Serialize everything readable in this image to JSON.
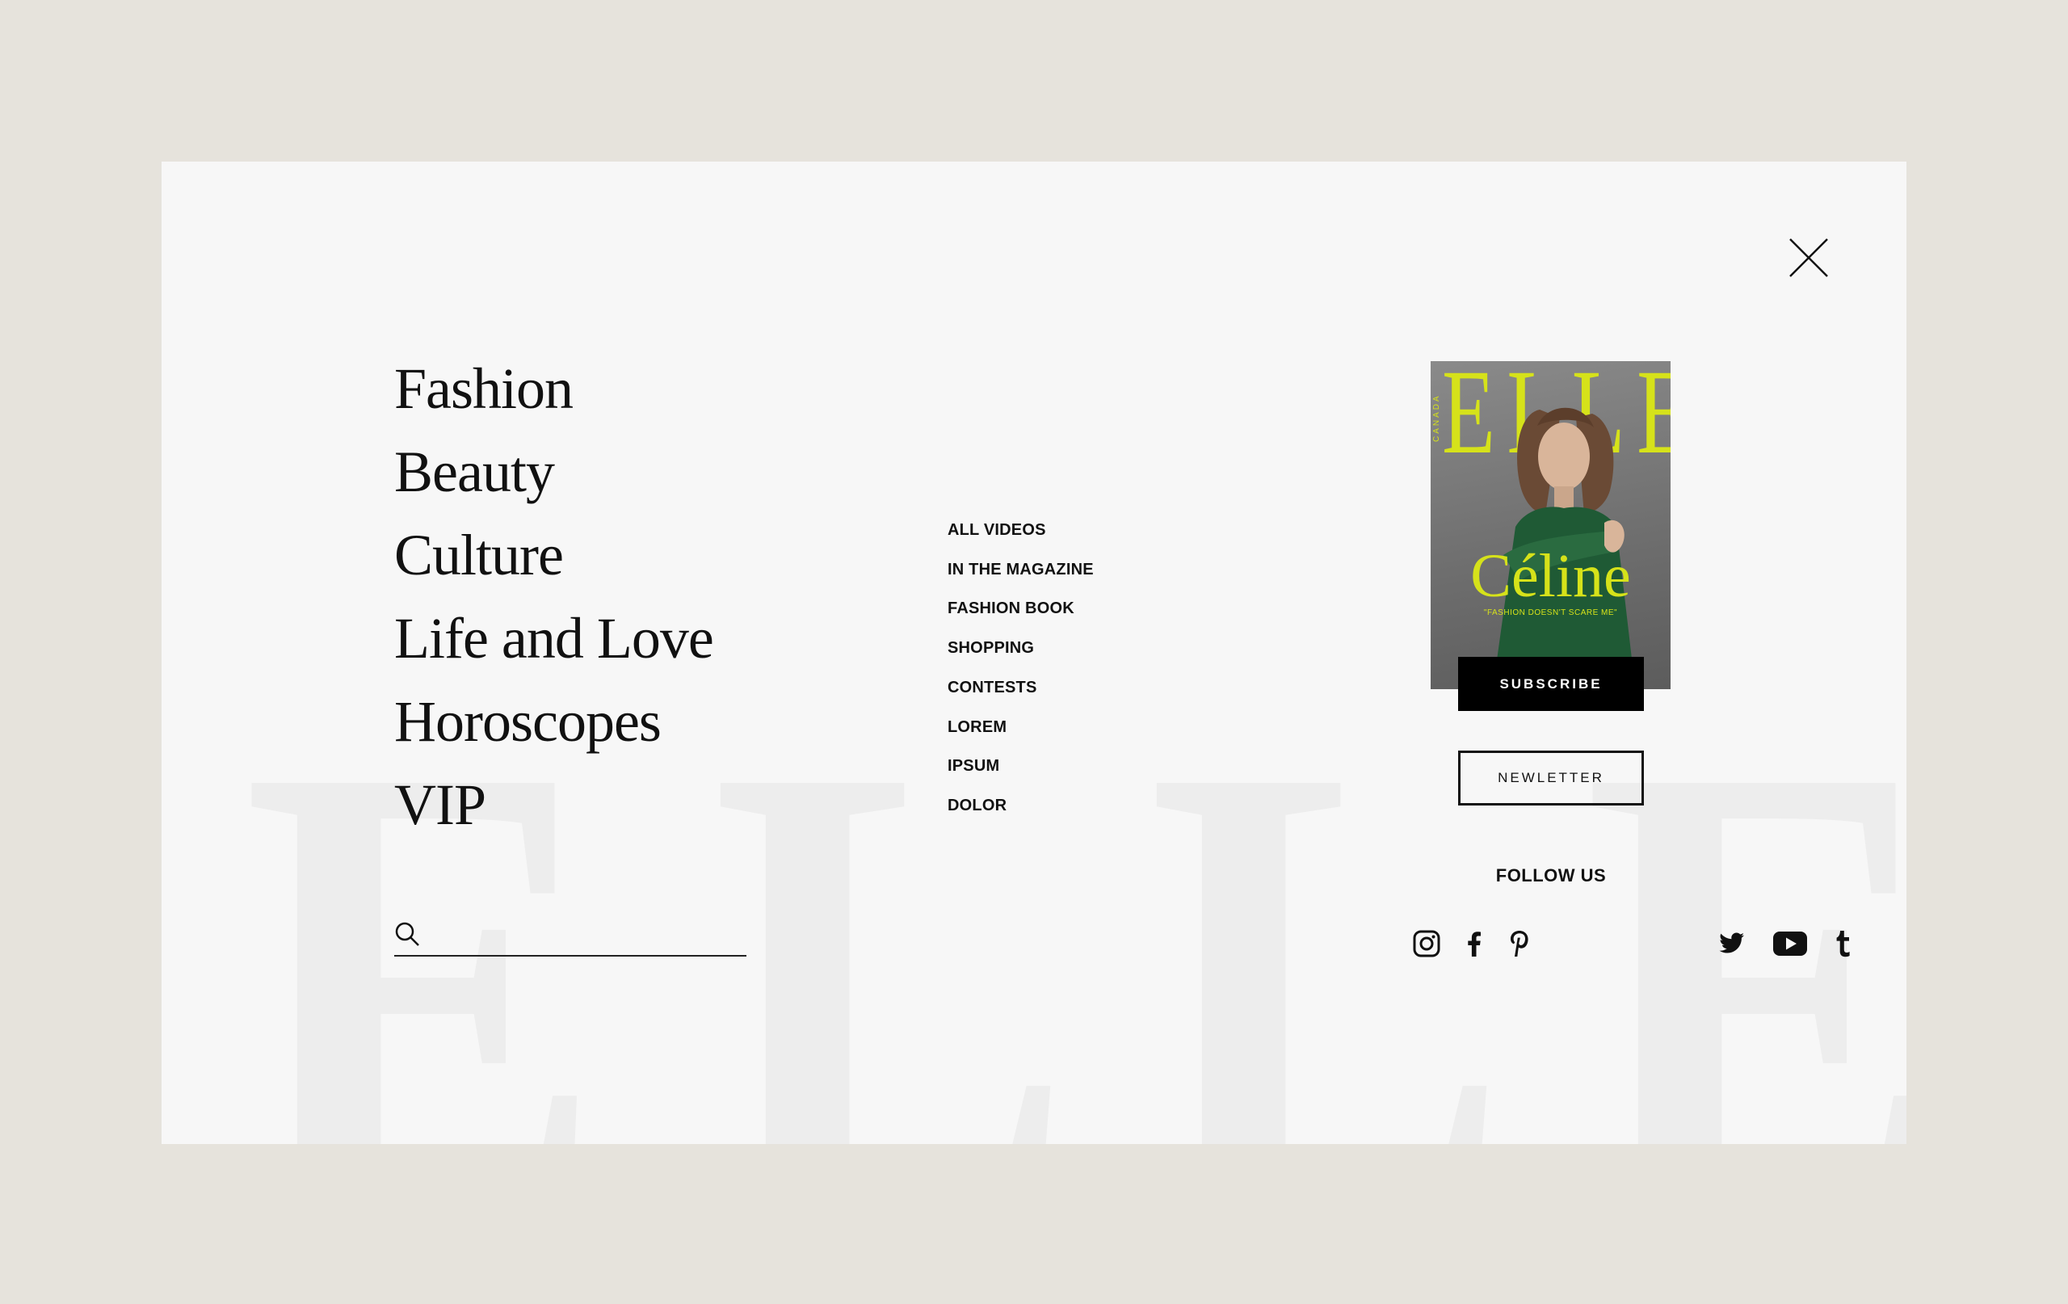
{
  "menu": {
    "main_nav": [
      {
        "label": "Fashion"
      },
      {
        "label": "Beauty"
      },
      {
        "label": "Culture"
      },
      {
        "label": "Life and Love"
      },
      {
        "label": "Horoscopes"
      },
      {
        "label": "VIP"
      }
    ],
    "sub_nav": [
      {
        "label": "ALL VIDEOS"
      },
      {
        "label": "IN THE MAGAZINE"
      },
      {
        "label": "FASHION BOOK"
      },
      {
        "label": "SHOPPING"
      },
      {
        "label": "CONTESTS"
      },
      {
        "label": "LOREM"
      },
      {
        "label": "IPSUM"
      },
      {
        "label": "DOLOR"
      }
    ],
    "search": {
      "value": "",
      "placeholder": ""
    },
    "watermark": {
      "letters": [
        "E",
        "L",
        "L",
        "E"
      ]
    }
  },
  "magazine": {
    "masthead": "ELLE",
    "edition": "CANADA",
    "cover_name": "Céline",
    "cover_tagline": "\"FASHION DOESN'T SCARE ME\"",
    "subscribe_label": "SUBSCRIBE",
    "newsletter_label": "NEWLETTER"
  },
  "social": {
    "title": "FOLLOW US",
    "icons": [
      "instagram-icon",
      "facebook-icon",
      "pinterest-icon",
      "twitter-icon",
      "youtube-icon",
      "tumblr-icon"
    ]
  },
  "colors": {
    "page_bg": "#e6e3dc",
    "panel_bg": "#f7f7f7",
    "text": "#111111",
    "cover_accent": "#d6e21a",
    "watermark": "#ededed"
  }
}
